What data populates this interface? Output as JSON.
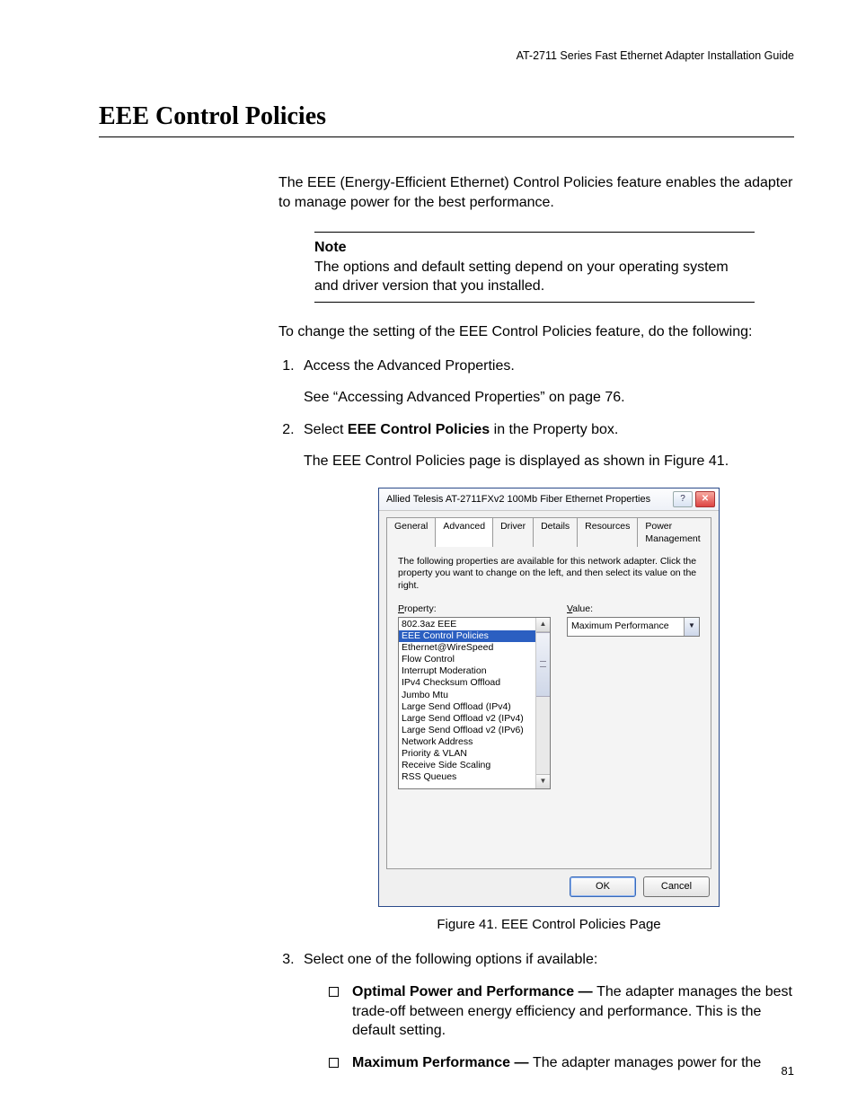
{
  "running_head": "AT-2711 Series Fast Ethernet Adapter Installation Guide",
  "section_title": "EEE Control Policies",
  "intro": "The EEE (Energy-Efficient Ethernet) Control Policies feature enables the adapter to manage power for the best performance.",
  "note": {
    "label": "Note",
    "text": "The options and default setting depend on your operating system and driver version that you installed."
  },
  "lead_in": "To change the setting of the EEE Control Policies feature, do the following:",
  "steps": {
    "s1": "Access the Advanced Properties.",
    "s1_sub": "See “Accessing Advanced Properties” on page 76.",
    "s2_pre": "Select ",
    "s2_bold": "EEE Control Policies",
    "s2_post": " in the Property box.",
    "s2_sub": "The EEE Control Policies page is displayed as shown in Figure 41.",
    "s3": "Select one of the following options if available:"
  },
  "options": {
    "opt1_bold": "Optimal Power and Performance — ",
    "opt1_rest": "The adapter manages the best trade-off between energy efficiency and performance. This is the default setting.",
    "opt2_bold": "Maximum Performance — ",
    "opt2_rest": "The adapter manages power for the"
  },
  "figure_caption": "Figure 41. EEE Control Policies Page",
  "page_number": "81",
  "dialog": {
    "title": "Allied Telesis AT-2711FXv2 100Mb Fiber Ethernet Properties",
    "tabs": [
      "General",
      "Advanced",
      "Driver",
      "Details",
      "Resources",
      "Power Management"
    ],
    "active_tab": 1,
    "desc": "The following properties are available for this network adapter. Click the property you want to change on the left, and then select its value on the right.",
    "property_label": "Property:",
    "value_label": "Value:",
    "properties": [
      "802.3az EEE",
      "EEE Control Policies",
      "Ethernet@WireSpeed",
      "Flow Control",
      "Interrupt Moderation",
      "IPv4 Checksum Offload",
      "Jumbo Mtu",
      "Large Send Offload (IPv4)",
      "Large Send Offload v2 (IPv4)",
      "Large Send Offload v2 (IPv6)",
      "Network Address",
      "Priority & VLAN",
      "Receive Side Scaling",
      "RSS Queues"
    ],
    "selected_property_index": 1,
    "value_selected": "Maximum Performance",
    "ok": "OK",
    "cancel": "Cancel"
  },
  "chart_data": {
    "type": "table",
    "title": "Advanced Properties list (visible rows)",
    "categories": [
      "Property"
    ],
    "series": [
      {
        "name": "rows",
        "values": [
          "802.3az EEE",
          "EEE Control Policies",
          "Ethernet@WireSpeed",
          "Flow Control",
          "Interrupt Moderation",
          "IPv4 Checksum Offload",
          "Jumbo Mtu",
          "Large Send Offload (IPv4)",
          "Large Send Offload v2 (IPv4)",
          "Large Send Offload v2 (IPv6)",
          "Network Address",
          "Priority & VLAN",
          "Receive Side Scaling",
          "RSS Queues"
        ]
      }
    ],
    "selected": "EEE Control Policies",
    "value_combo": "Maximum Performance"
  }
}
